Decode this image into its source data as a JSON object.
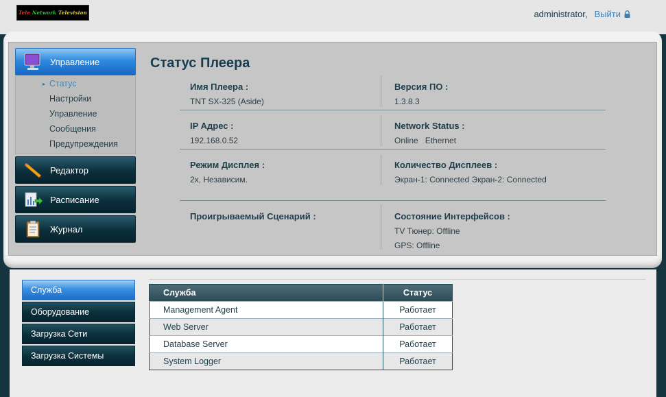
{
  "header": {
    "logo": {
      "part1": "Tele",
      "part2": "Network",
      "part3": "Television"
    },
    "username": "administrator,",
    "logout_label": "Выйти",
    "logout_icon": "lock-icon"
  },
  "menu": {
    "sections": [
      {
        "label": "Управление",
        "icon": "monitor-icon",
        "active": true
      },
      {
        "label": "Редактор",
        "icon": "pencil-icon"
      },
      {
        "label": "Расписание",
        "icon": "schedule-icon"
      },
      {
        "label": "Журнал",
        "icon": "clipboard-icon"
      }
    ],
    "sub_items": [
      "Статус",
      "Настройки",
      "Управление",
      "Сообщения",
      "Предупреждения"
    ],
    "current_sub": "Статус"
  },
  "status": {
    "title": "Статус Плеера",
    "player_name_label": "Имя Плеера :",
    "player_name_value": "TNT SX-325 (Aside)",
    "version_label": "Версия ПО :",
    "version_value": "1.3.8.3",
    "ip_label": "IP Адрес :",
    "ip_value": "192.168.0.52",
    "network_label": "Network Status :",
    "network_value": "Online   Ethernet",
    "display_mode_label": "Режим Дисплея :",
    "display_mode_value": "2x, Независим.",
    "display_count_label": "Количество Дисплеев :",
    "display_count_value": "Экран-1: Connected Экран-2: Connected",
    "scenario_label": "Проигрываемый Сценарий :",
    "interfaces_label": "Состояние Интерфейсов :",
    "tv_tuner_value": "TV Тюнер: Offline",
    "gps_value": "GPS: Offline"
  },
  "bottom_nav": [
    "Служба",
    "Оборудование",
    "Загрузка Сети",
    "Загрузка Системы"
  ],
  "services": {
    "headers": [
      "Служба",
      "Статус"
    ],
    "rows": [
      [
        "Management Agent",
        "Работает"
      ],
      [
        "Web Server",
        "Работает"
      ],
      [
        "Database Server",
        "Работает"
      ],
      [
        "System Logger",
        "Работает"
      ]
    ]
  },
  "colors": {
    "accent": "#2f8be0",
    "dark": "#0b2f3c",
    "link": "#3f7fb0"
  }
}
